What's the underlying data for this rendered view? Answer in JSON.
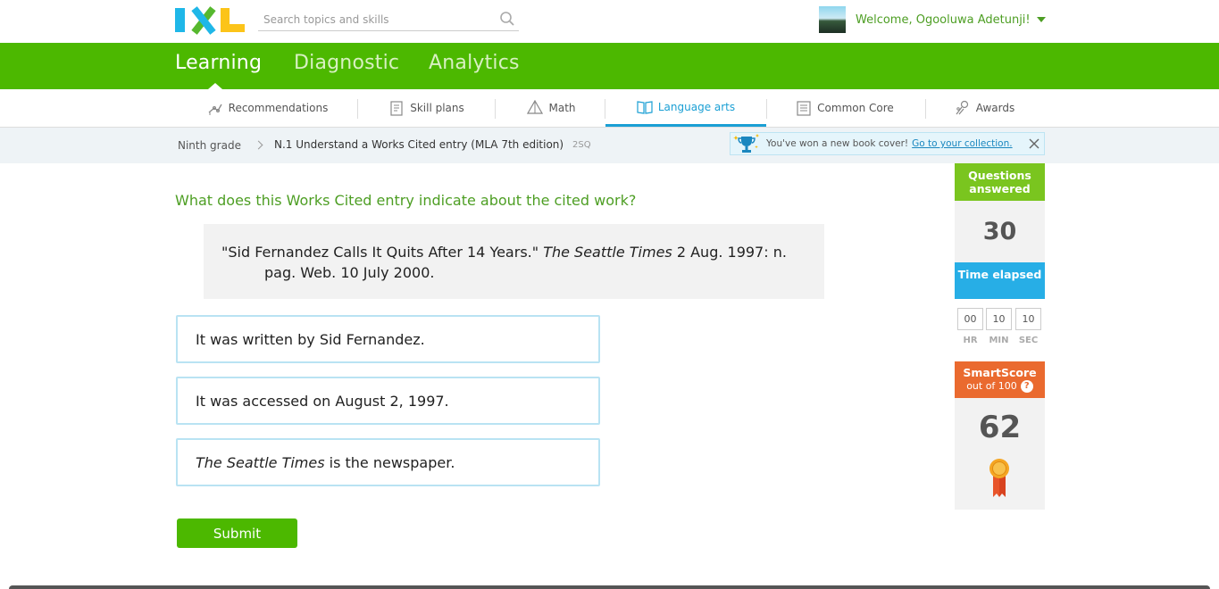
{
  "header": {
    "search_placeholder": "Search topics and skills",
    "welcome": "Welcome, Ogooluwa Adetunji!"
  },
  "main_nav": {
    "tabs": [
      {
        "label": "Learning",
        "active": true
      },
      {
        "label": "Diagnostic",
        "active": false
      },
      {
        "label": "Analytics",
        "active": false
      }
    ]
  },
  "subject_nav": {
    "tabs": [
      {
        "label": "Recommendations",
        "icon": "recommendations-icon"
      },
      {
        "label": "Skill plans",
        "icon": "skill-plans-icon"
      },
      {
        "label": "Math",
        "icon": "math-icon"
      },
      {
        "label": "Language arts",
        "icon": "language-arts-icon",
        "active": true
      },
      {
        "label": "Common Core",
        "icon": "common-core-icon"
      },
      {
        "label": "Awards",
        "icon": "awards-icon"
      }
    ]
  },
  "breadcrumb": {
    "grade": "Ninth grade",
    "skill": "N.1 Understand a Works Cited entry (MLA 7th edition)",
    "code": "2SQ"
  },
  "notification": {
    "text": "You've won a new book cover!",
    "link": "Go to your collection."
  },
  "question": {
    "prompt": "What does this Works Cited entry indicate about the cited work?",
    "citation_pre": "\"Sid Fernandez Calls It Quits After 14 Years.\" ",
    "citation_italic": "The Seattle Times",
    "citation_post": " 2 Aug. 1997: n.",
    "citation_line2": "pag. Web. 10 July 2000."
  },
  "answers": [
    {
      "text": "It was written by Sid Fernandez."
    },
    {
      "text": "It was accessed on August 2, 1997."
    },
    {
      "italic": "The Seattle Times",
      "text": " is the newspaper."
    }
  ],
  "submit_label": "Submit",
  "stats": {
    "questions_label": "Questions answered",
    "questions_value": "30",
    "time_label": "Time elapsed",
    "time": {
      "hr": "00",
      "min": "10",
      "sec": "10"
    },
    "time_units": {
      "hr": "HR",
      "min": "MIN",
      "sec": "SEC"
    },
    "smartscore_label": "SmartScore",
    "smartscore_sub": "out of 100",
    "smartscore_help": "?",
    "smartscore_value": "62"
  },
  "colors": {
    "brand_green": "#4cb800",
    "accent_blue": "#1a9fd4",
    "smartscore_orange": "#ea6a2f"
  }
}
